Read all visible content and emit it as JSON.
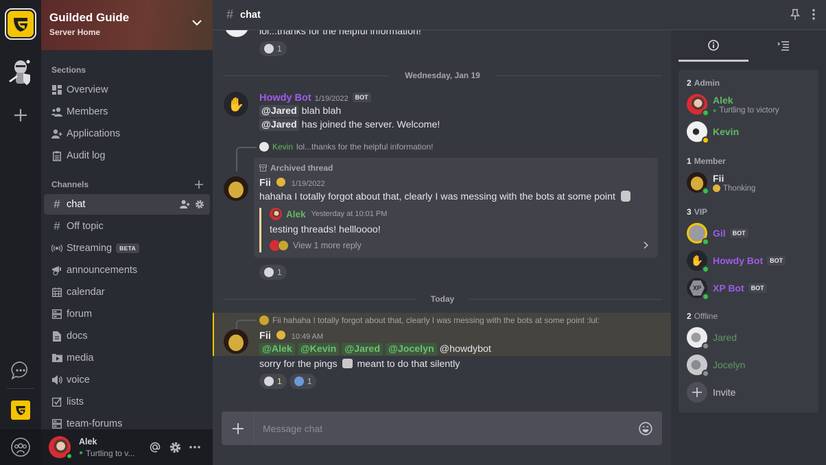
{
  "server": {
    "name": "Guilded Guide",
    "subtitle": "Server Home",
    "brand_color": "#f5c400"
  },
  "sidebar": {
    "sections_label": "Sections",
    "sections": [
      {
        "label": "Overview",
        "icon": "overview-icon"
      },
      {
        "label": "Members",
        "icon": "members-icon"
      },
      {
        "label": "Applications",
        "icon": "applications-icon"
      },
      {
        "label": "Audit log",
        "icon": "audit-log-icon"
      }
    ],
    "channels_label": "Channels",
    "channels": [
      {
        "label": "chat",
        "icon": "hash-icon",
        "active": true
      },
      {
        "label": "Off topic",
        "icon": "hash-icon"
      },
      {
        "label": "Streaming",
        "icon": "streaming-icon",
        "badge": "BETA"
      },
      {
        "label": "announcements",
        "icon": "announcements-icon"
      },
      {
        "label": "calendar",
        "icon": "calendar-icon"
      },
      {
        "label": "forum",
        "icon": "forum-icon"
      },
      {
        "label": "docs",
        "icon": "docs-icon"
      },
      {
        "label": "media",
        "icon": "media-icon"
      },
      {
        "label": "voice",
        "icon": "voice-icon"
      },
      {
        "label": "lists",
        "icon": "lists-icon"
      },
      {
        "label": "team-forums",
        "icon": "forum-icon"
      }
    ]
  },
  "current_user": {
    "name": "Alek",
    "status": "Turtling to v..."
  },
  "channel": {
    "name": "chat"
  },
  "messages": {
    "partial_top": {
      "text": "lol...thanks for the helpful information!",
      "reaction_count": "1"
    },
    "date_sep_1": "Wednesday, Jan 19",
    "howdy": {
      "author": "Howdy Bot",
      "timestamp": "1/19/2022",
      "badge": "BOT",
      "line1_mention": "@Jared",
      "line1_text": "blah blah",
      "line2_mention": "@Jared",
      "line2_text": "has joined the server. Welcome!"
    },
    "fii_thread": {
      "reply_author": "Kevin",
      "reply_text": "lol...thanks for the helpful information!",
      "archived_label": "Archived thread",
      "author": "Fii",
      "timestamp": "1/19/2022",
      "text": "hahaha I totally forgot about that, clearly I was messing with the bots at some point",
      "thread_author": "Alek",
      "thread_timestamp": "Yesterday at 10:01 PM",
      "thread_text": "testing threads! hellloooo!",
      "view_more": "View 1 more reply",
      "reaction_count": "1"
    },
    "date_sep_2": "Today",
    "fii_today": {
      "reply_text": "Fii hahaha I totally forgot about that, clearly I was messing with the bots at some point :lul:",
      "author": "Fii",
      "timestamp": "10:49 AM",
      "mentions": [
        "@Alek",
        "@Kevin",
        "@Jared",
        "@Jocelyn"
      ],
      "plain_mention": "@howdybot",
      "text2_before": "sorry for the pings",
      "text2_after": "meant to do that silently",
      "reactions": [
        "1",
        "1"
      ]
    }
  },
  "composer": {
    "placeholder": "Message chat"
  },
  "members": {
    "groups": [
      {
        "count": "2",
        "label": "Admin",
        "members": [
          {
            "name": "Alek",
            "status": "Turtling to victory",
            "presence": "online"
          },
          {
            "name": "Kevin",
            "presence": "idle"
          }
        ]
      },
      {
        "count": "1",
        "label": "Member",
        "members": [
          {
            "name": "Fii",
            "status": "Thonking",
            "presence": "online"
          }
        ]
      },
      {
        "count": "3",
        "label": "VIP",
        "members": [
          {
            "name": "Gil",
            "badge": "BOT",
            "presence": "online"
          },
          {
            "name": "Howdy Bot",
            "badge": "BOT",
            "presence": "online"
          },
          {
            "name": "XP Bot",
            "badge": "BOT",
            "presence": "online"
          }
        ]
      },
      {
        "count": "2",
        "label": "Offline",
        "members": [
          {
            "name": "Jared",
            "presence": "offline"
          },
          {
            "name": "Jocelyn",
            "presence": "offline"
          }
        ]
      }
    ],
    "invite_label": "Invite"
  }
}
